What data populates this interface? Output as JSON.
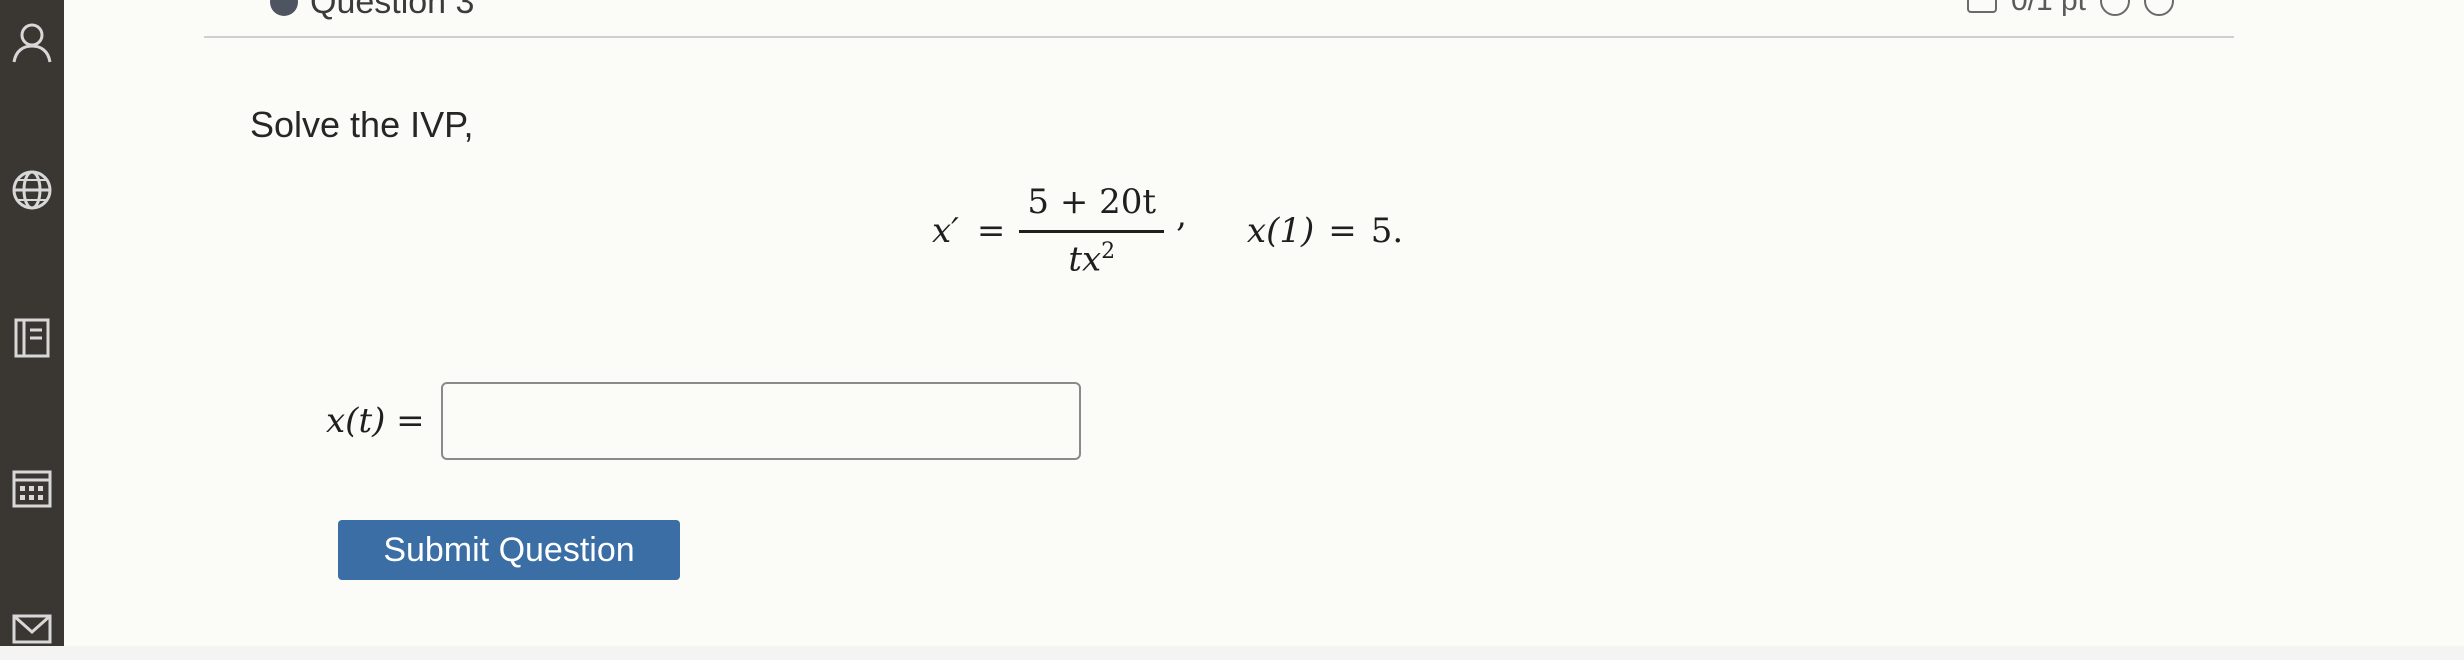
{
  "question": {
    "title": "Question 3",
    "points_partial": "0/1 pt"
  },
  "prompt": "Solve the IVP,",
  "equation": {
    "lhs": "x′",
    "equals": "=",
    "numerator": "5 + 20t",
    "denominator_base": "tx",
    "denominator_exp": "2",
    "comma": ",",
    "initial_condition_lhs": "x(1)",
    "initial_condition_equals": "=",
    "initial_condition_rhs": "5."
  },
  "answer": {
    "label": "x(t) =",
    "value": "",
    "placeholder": ""
  },
  "submit_label": "Submit Question",
  "colors": {
    "sidebar": "#3a3733",
    "button": "#3a6ea5",
    "button_text": "#ffffff"
  },
  "icons": [
    "user-icon",
    "globe-icon",
    "gradebook-icon",
    "calendar-icon",
    "inbox-icon"
  ]
}
